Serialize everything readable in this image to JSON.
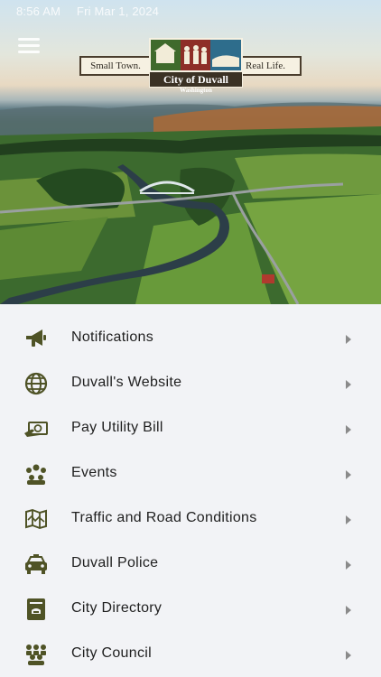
{
  "status_bar": {
    "time": "8:56 AM",
    "date": "Fri Mar 1, 2024"
  },
  "header": {
    "logo": {
      "left_ribbon": "Small Town.",
      "right_ribbon": "Real Life.",
      "title": "City of Duvall",
      "subtitle": "Washington"
    }
  },
  "menu": {
    "items": [
      {
        "label": "Notifications",
        "icon": "megaphone-icon"
      },
      {
        "label": "Duvall's Website",
        "icon": "globe-icon"
      },
      {
        "label": "Pay Utility Bill",
        "icon": "pay-bill-icon"
      },
      {
        "label": "Events",
        "icon": "people-group-icon"
      },
      {
        "label": "Traffic and Road Conditions",
        "icon": "map-icon"
      },
      {
        "label": "Duvall Police",
        "icon": "police-car-icon"
      },
      {
        "label": "City Directory",
        "icon": "phone-book-icon"
      },
      {
        "label": "City Council",
        "icon": "council-icon"
      }
    ]
  },
  "colors": {
    "icon": "#4f5326",
    "chevron": "#8a8a8a",
    "background": "#f2f3f6"
  }
}
